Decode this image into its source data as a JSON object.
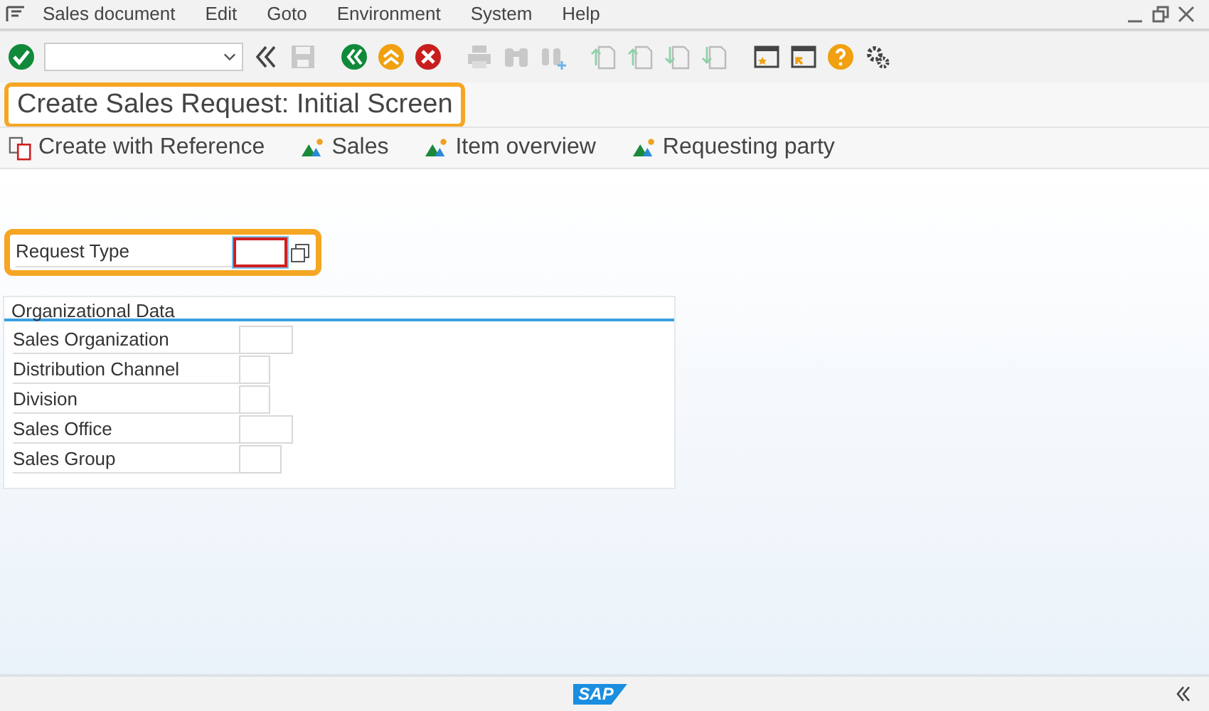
{
  "menu": [
    "Sales document",
    "Edit",
    "Goto",
    "Environment",
    "System",
    "Help"
  ],
  "title": "Create Sales Request: Initial Screen",
  "app_toolbar": [
    {
      "kind": "reference",
      "label": "Create with Reference"
    },
    {
      "kind": "mountain",
      "label": "Sales"
    },
    {
      "kind": "mountain",
      "label": "Item overview"
    },
    {
      "kind": "mountain",
      "label": "Requesting party"
    }
  ],
  "request_type": {
    "label": "Request Type"
  },
  "org_data": {
    "title": "Organizational Data",
    "fields": [
      {
        "label": "Sales Organization"
      },
      {
        "label": "Distribution Channel"
      },
      {
        "label": "Division"
      },
      {
        "label": "Sales Office"
      },
      {
        "label": "Sales Group"
      }
    ]
  },
  "footer": {
    "logo": "SAP"
  }
}
